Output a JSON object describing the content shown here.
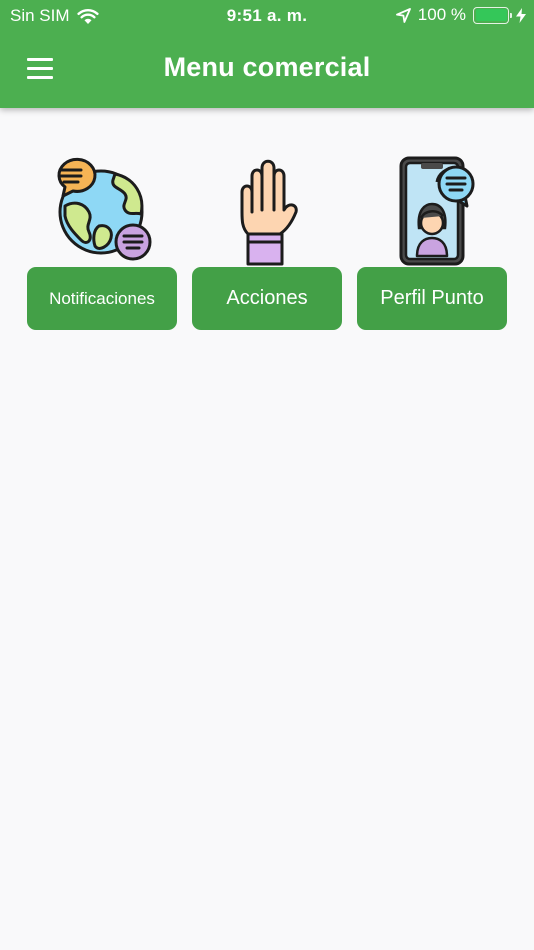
{
  "status_bar": {
    "carrier": "Sin SIM",
    "time": "9:51 a. m.",
    "battery": "100 %",
    "battery_color": "#34c759"
  },
  "app_bar": {
    "title": "Menu comercial",
    "menu_icon": "hamburger-menu-icon",
    "color": "#4caf50"
  },
  "menu_items": [
    {
      "label": "Notificaciones",
      "icon": "globe-chat-icon"
    },
    {
      "label": "Acciones",
      "icon": "raised-hand-icon"
    },
    {
      "label": "Perfil Punto",
      "icon": "phone-profile-icon"
    }
  ],
  "button_color": "#43a047",
  "background": "#f9f9fa"
}
